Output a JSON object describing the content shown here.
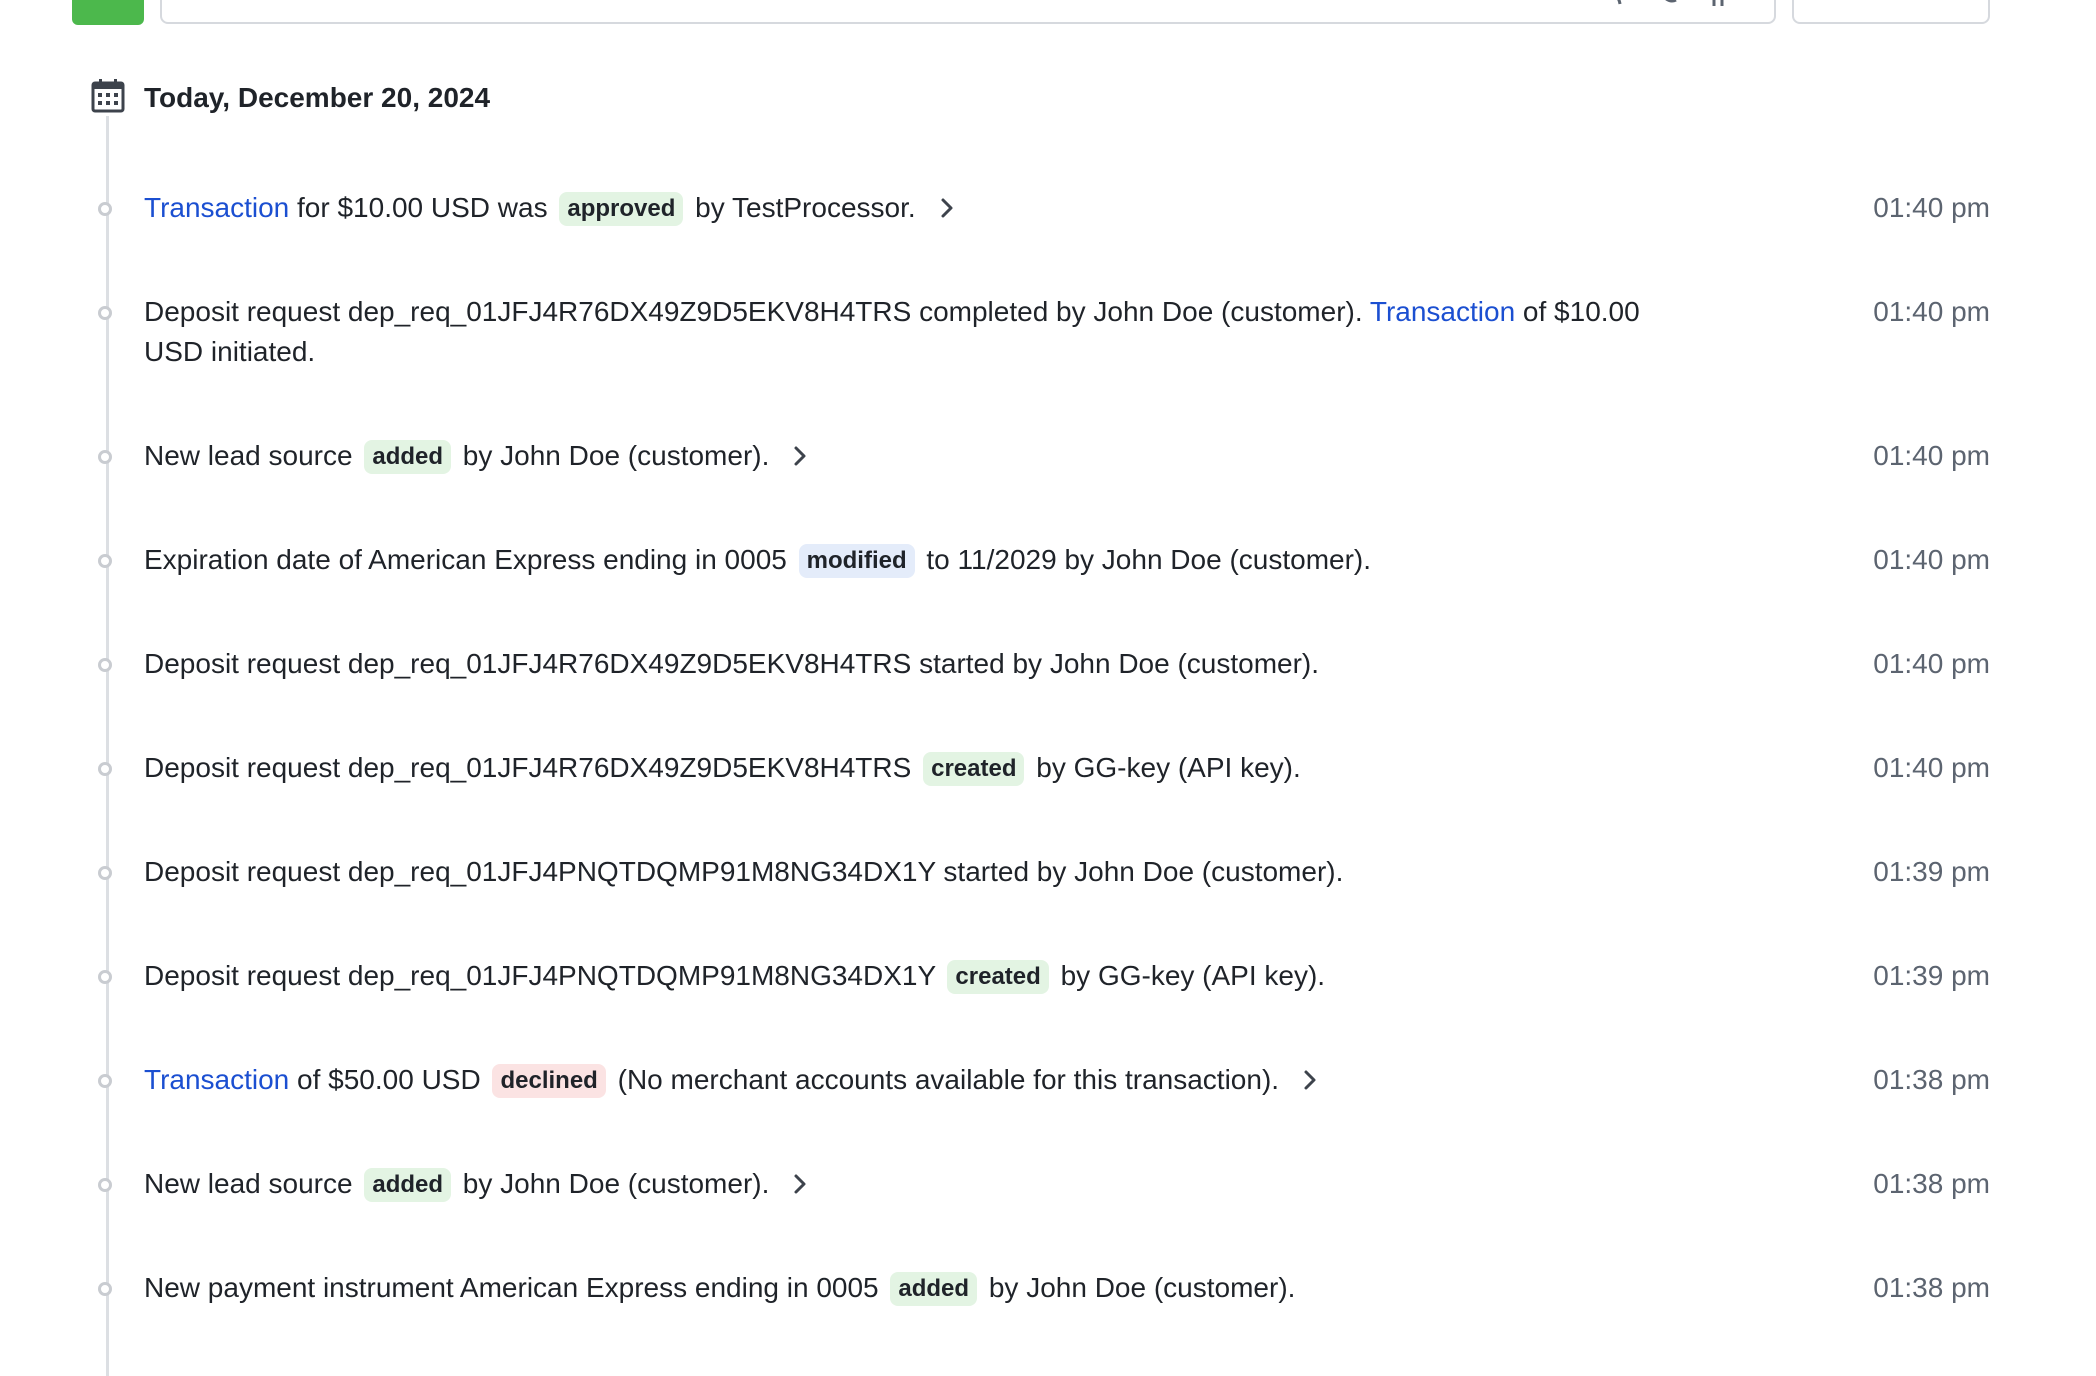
{
  "header": {
    "date_title": "Today, December 20, 2024"
  },
  "events": [
    {
      "parts": [
        {
          "t": "link",
          "v": "Transaction"
        },
        {
          "t": "text",
          "v": " for $10.00 USD was "
        },
        {
          "t": "badge",
          "v": "approved",
          "c": "green"
        },
        {
          "t": "text",
          "v": " by TestProcessor."
        }
      ],
      "expandable": true,
      "time": "01:40 pm"
    },
    {
      "parts": [
        {
          "t": "text",
          "v": "Deposit request dep_req_01JFJ4R76DX49Z9D5EKV8H4TRS completed by John Doe (customer). "
        },
        {
          "t": "link",
          "v": "Transaction"
        },
        {
          "t": "text",
          "v": " of $10.00 USD initiated."
        }
      ],
      "expandable": false,
      "time": "01:40 pm"
    },
    {
      "parts": [
        {
          "t": "text",
          "v": "New lead source "
        },
        {
          "t": "badge",
          "v": "added",
          "c": "green"
        },
        {
          "t": "text",
          "v": " by John Doe (customer)."
        }
      ],
      "expandable": true,
      "time": "01:40 pm"
    },
    {
      "parts": [
        {
          "t": "text",
          "v": "Expiration date of American Express ending in 0005 "
        },
        {
          "t": "badge",
          "v": "modified",
          "c": "blue"
        },
        {
          "t": "text",
          "v": " to 11/2029 by John Doe (customer)."
        }
      ],
      "expandable": false,
      "time": "01:40 pm"
    },
    {
      "parts": [
        {
          "t": "text",
          "v": "Deposit request dep_req_01JFJ4R76DX49Z9D5EKV8H4TRS started by John Doe (customer)."
        }
      ],
      "expandable": false,
      "time": "01:40 pm"
    },
    {
      "parts": [
        {
          "t": "text",
          "v": "Deposit request dep_req_01JFJ4R76DX49Z9D5EKV8H4TRS "
        },
        {
          "t": "badge",
          "v": "created",
          "c": "green"
        },
        {
          "t": "text",
          "v": " by GG-key (API key)."
        }
      ],
      "expandable": false,
      "time": "01:40 pm"
    },
    {
      "parts": [
        {
          "t": "text",
          "v": "Deposit request dep_req_01JFJ4PNQTDQMP91M8NG34DX1Y started by John Doe (customer)."
        }
      ],
      "expandable": false,
      "time": "01:39 pm"
    },
    {
      "parts": [
        {
          "t": "text",
          "v": "Deposit request dep_req_01JFJ4PNQTDQMP91M8NG34DX1Y "
        },
        {
          "t": "badge",
          "v": "created",
          "c": "green"
        },
        {
          "t": "text",
          "v": " by GG-key (API key)."
        }
      ],
      "expandable": false,
      "time": "01:39 pm"
    },
    {
      "parts": [
        {
          "t": "link",
          "v": "Transaction"
        },
        {
          "t": "text",
          "v": " of $50.00 USD "
        },
        {
          "t": "badge",
          "v": "declined",
          "c": "red"
        },
        {
          "t": "text",
          "v": " (No merchant accounts available for this transaction)."
        }
      ],
      "expandable": true,
      "time": "01:38 pm"
    },
    {
      "parts": [
        {
          "t": "text",
          "v": "New lead source "
        },
        {
          "t": "badge",
          "v": "added",
          "c": "green"
        },
        {
          "t": "text",
          "v": " by John Doe (customer)."
        }
      ],
      "expandable": true,
      "time": "01:38 pm"
    },
    {
      "parts": [
        {
          "t": "text",
          "v": "New payment instrument American Express ending in 0005 "
        },
        {
          "t": "badge",
          "v": "added",
          "c": "green"
        },
        {
          "t": "text",
          "v": " by John Doe (customer)."
        }
      ],
      "expandable": false,
      "time": "01:38 pm"
    }
  ],
  "colors": {
    "link": "#1b4fd1",
    "badge_green": "#e3f4e3",
    "badge_blue": "#e4ecfa",
    "badge_red": "#fbe3e3",
    "accent_button": "#4cb84c"
  }
}
